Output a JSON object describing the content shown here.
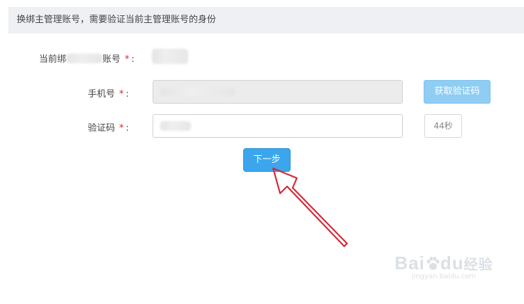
{
  "notice": {
    "text": "换绑主管理账号，需要验证当前主管理账号的身份"
  },
  "form": {
    "current_account": {
      "label_prefix": "当前绑",
      "label_suffix": "账号",
      "required_mark": "*",
      "colon": ":"
    },
    "phone": {
      "label": "手机号",
      "required_mark": "*",
      "colon": ":",
      "value": "",
      "get_code_label": "获取验证码"
    },
    "code": {
      "label": "验证码",
      "required_mark": "*",
      "colon": ":",
      "value": "",
      "countdown": "44秒"
    },
    "next_label": "下一步"
  },
  "annotation": {
    "arrow_color": "#d42a36"
  },
  "watermark": {
    "logo_left": "Bai",
    "logo_right": "du",
    "logo_cn": "经验",
    "url": "jingyan.baidu.com"
  },
  "colors": {
    "primary": "#3ba6ec",
    "primary_light": "#8fcdf3",
    "required": "#e02020",
    "notice_bg": "#eef0f3"
  }
}
